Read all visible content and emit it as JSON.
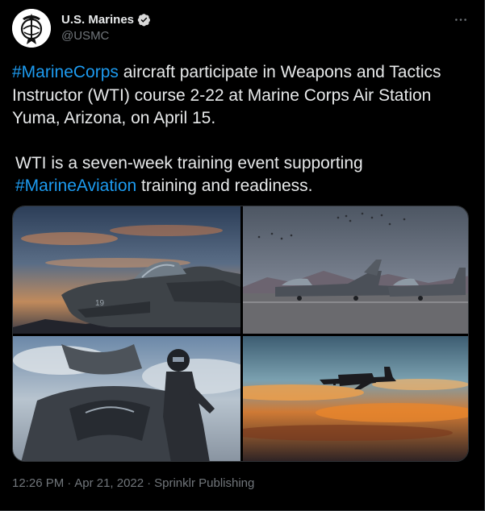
{
  "account": {
    "display_name": "U.S. Marines",
    "handle": "@USMC",
    "verified": true,
    "avatar_icon": "usmc-emblem-icon",
    "accent_color": "#1d9bf0"
  },
  "tweet": {
    "para1_hashtag": "#MarineCorps",
    "para1_text": " aircraft participate in Weapons and Tactics Instructor (WTI) course 2-22 at Marine Corps Air Station Yuma, Arizona, on April 15.",
    "para2_text": "WTI is a seven-week training event supporting ",
    "para2_hashtag": "#MarineAviation",
    "para2_tail": " training and readiness."
  },
  "media": [
    {
      "icon": "harrier-jet-dusk-photo"
    },
    {
      "icon": "jets-on-flightline-photo"
    },
    {
      "icon": "pilot-f35-cockpit-photo"
    },
    {
      "icon": "c130-sunset-photo"
    }
  ],
  "meta": {
    "time": "12:26 PM",
    "sep1": "·",
    "date": "Apr 21, 2022",
    "sep2": "·",
    "source": "Sprinklr Publishing"
  }
}
